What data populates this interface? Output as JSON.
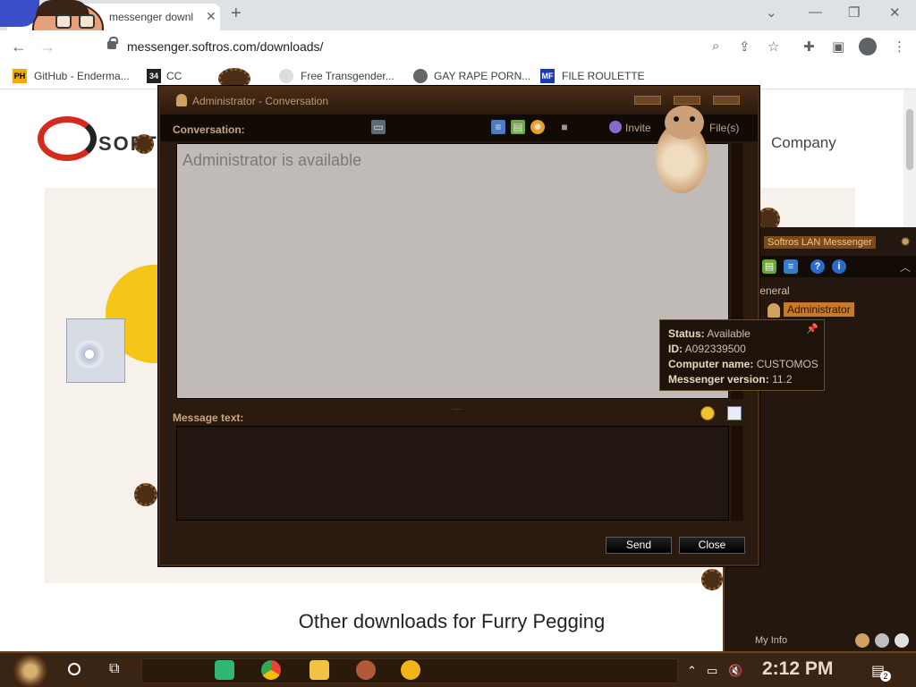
{
  "browser": {
    "tab_title": "messenger downl",
    "url": "messenger.softros.com/downloads/",
    "bookmarks": [
      {
        "icon_text": "PH",
        "label": "GitHub - Enderma..."
      },
      {
        "icon_text": "34",
        "label": "CC"
      },
      {
        "icon_text": "",
        "label": "Free Transgender..."
      },
      {
        "icon_text": "",
        "label": "GAY RAPE PORN..."
      },
      {
        "icon_text": "MF",
        "label": "FILE ROULETTE"
      }
    ]
  },
  "page": {
    "logo_text": "SOFT",
    "company_text": "Company",
    "other_downloads": "Other downloads for Furry Pegging"
  },
  "conversation": {
    "title": "Administrator - Conversation",
    "conversation_label": "Conversation:",
    "invite_label": "Invite",
    "files_label": "File(s)",
    "status_text": "Administrator is available",
    "message_label": "Message text:",
    "send_label": "Send",
    "close_label": "Close"
  },
  "messenger_main": {
    "title": "Softros LAN Messenger",
    "group": "General",
    "user": "Administrator",
    "my_info": "My Info"
  },
  "tooltip": {
    "status_key": "Status:",
    "status_val": "Available",
    "id_key": "ID:",
    "id_val": "A092339500",
    "computer_key": "Computer name:",
    "computer_val": "CUSTOMOS",
    "version_key": "Messenger version:",
    "version_val": "11.2"
  },
  "taskbar": {
    "time": "2:12 PM",
    "notification_count": "2"
  },
  "colors": {
    "accent": "#c87a2c",
    "window_bg": "#2a1a10"
  }
}
